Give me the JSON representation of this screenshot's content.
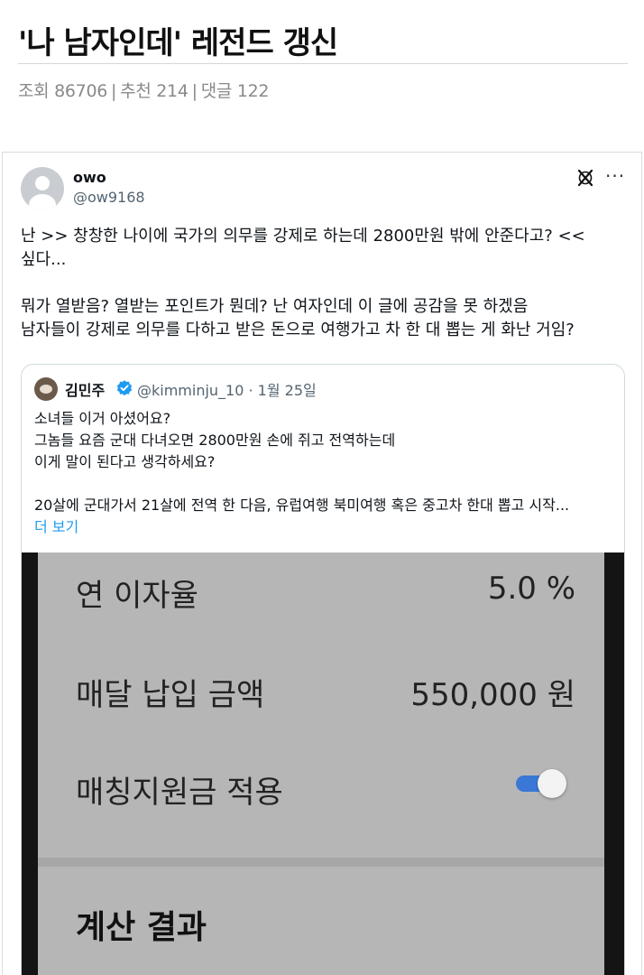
{
  "post": {
    "title": "'나 남자인데' 레전드 갱신",
    "meta": {
      "views": "조회 86706",
      "recommends": "추천 214",
      "comments": "댓글 122",
      "separator": "|"
    }
  },
  "tweet": {
    "display_name": "owo",
    "handle": "@ow9168",
    "icons": {
      "avatar": "default-avatar-icon",
      "platform": "x-logo-icon",
      "menu": "more-dots-icon"
    },
    "menu_label": "···",
    "body_lines": [
      "난 >> 창창한 나이에 국가의 의무를 강제로 하는데 2800만원 밖에 안준다고? <<",
      "싶다...",
      "",
      "뭐가 열받음? 열받는 포인트가 뭔데? 난 여자인데 이 글에 공감을 못 하겠음",
      "남자들이 강제로 의무를 다하고 받은 돈으로 여행가고 차 한 대 뽑는 게 화난 거임?"
    ]
  },
  "quote": {
    "display_name": "김민주",
    "handle_date": "@kimminju_10 · 1월 25일",
    "verified_icon": "verified-badge-icon",
    "text_lines": [
      "소녀들 이거 아셨어요?",
      "그놈들 요즘 군대 다녀오면 2800만원 손에 쥐고 전역하는데",
      "이게 말이 된다고 생각하세요?",
      "",
      "20살에 군대가서 21살에 전역 한 다음, 유럽여행 북미여행 혹은 중고차 한대 뽑고 시작..."
    ],
    "more_label": "더 보기",
    "image": {
      "rows": [
        {
          "label": "연 이자율",
          "value": "5.0  %"
        },
        {
          "label": "매달 납입 금액",
          "value": "550,000  원"
        },
        {
          "label": "매칭지원금 적용",
          "toggle": "on"
        }
      ],
      "result_label": "계산 결과"
    }
  },
  "colors": {
    "link": "#1d9bf0",
    "toggle_on": "#3b78d6",
    "meta_gray": "#8a8a8a"
  }
}
